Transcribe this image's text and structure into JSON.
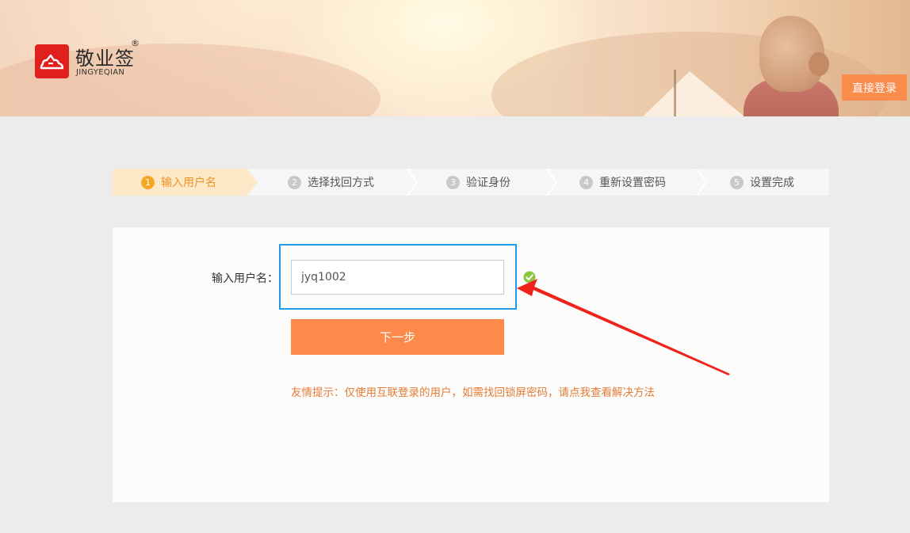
{
  "header": {
    "brand_name_cn": "敬业签",
    "brand_reg_mark": "®",
    "brand_name_en": "JINGYEQIAN",
    "direct_login_label": "直接登录"
  },
  "steps": [
    {
      "number": "1",
      "label": "输入用户名",
      "active": true
    },
    {
      "number": "2",
      "label": "选择找回方式",
      "active": false
    },
    {
      "number": "3",
      "label": "验证身份",
      "active": false
    },
    {
      "number": "4",
      "label": "重新设置密码",
      "active": false
    },
    {
      "number": "5",
      "label": "设置完成",
      "active": false
    }
  ],
  "form": {
    "username_label": "输入用户名：",
    "username_value": "jyq1002",
    "next_label": "下一步",
    "tip": "友情提示：仅使用互联登录的用户，如需找回锁屏密码，请点我查看解决方法"
  },
  "colors": {
    "brand_red": "#e0201d",
    "accent_orange": "#fd8a4a",
    "step_active": "#f39021",
    "highlight_blue": "#1e9be8",
    "check_green": "#8dc63f"
  }
}
